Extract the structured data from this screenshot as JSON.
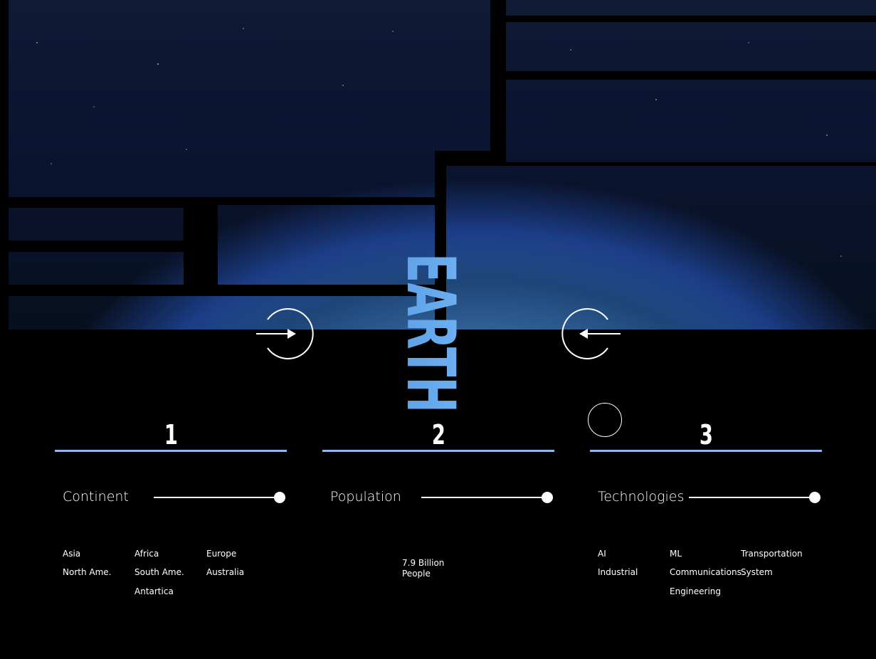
{
  "hero": {
    "title": "EARTH"
  },
  "navigation": {
    "next_icon": "arrow-right-circle-icon",
    "prev_icon": "arrow-left-circle-icon"
  },
  "colors": {
    "accent": "#8ab9ea",
    "title": "#6fb1f2"
  },
  "sections": [
    {
      "number": "1",
      "label": "Continent",
      "items": [
        "Asia",
        "Africa",
        "Europe",
        "North Ame.",
        "South Ame.",
        "Australia",
        "Antartica"
      ]
    },
    {
      "number": "2",
      "label": "Population",
      "value_line1": "7.9 Billion",
      "value_line2": "People"
    },
    {
      "number": "3",
      "label": "Technologies",
      "items": [
        "AI",
        "ML",
        "Transportation",
        "Industrial",
        "Communications",
        "System",
        "Engineering"
      ]
    }
  ]
}
